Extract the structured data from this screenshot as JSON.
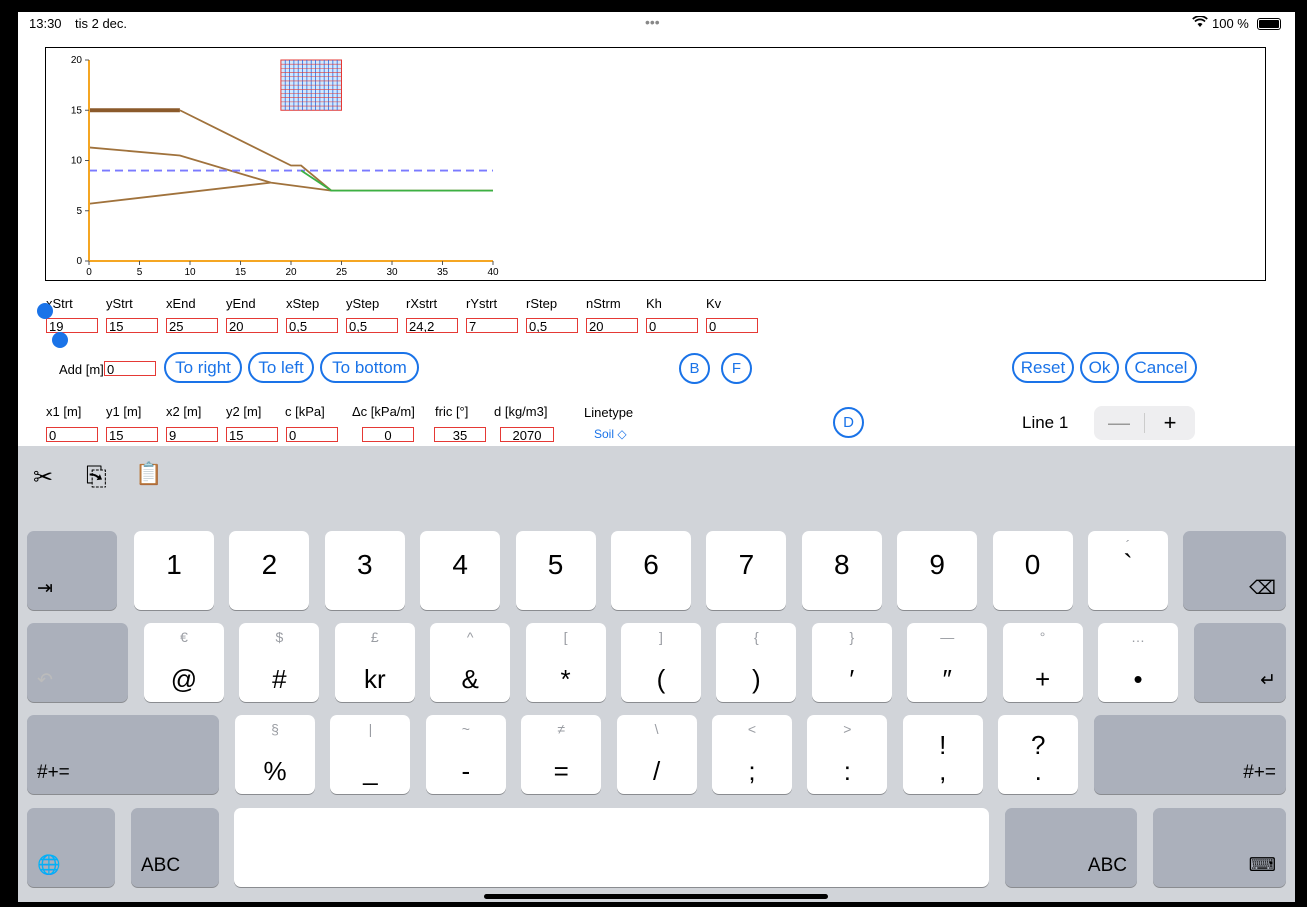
{
  "status": {
    "time": "13:30",
    "date": "tis 2 dec.",
    "battery": "100 %",
    "dots": "•••"
  },
  "chart_data": {
    "type": "line",
    "xlim": [
      0,
      40
    ],
    "ylim": [
      0,
      20
    ],
    "x_ticks": [
      "0",
      "5",
      "10",
      "15",
      "20",
      "25",
      "30",
      "35",
      "40"
    ],
    "y_ticks": [
      "0",
      "5",
      "10",
      "15",
      "20"
    ],
    "series": [
      {
        "values": [
          [
            0,
            15
          ],
          [
            9,
            15
          ]
        ],
        "color": "#8b5a2b"
      },
      {
        "values": [
          [
            9,
            15
          ],
          [
            20,
            9.5
          ],
          [
            21,
            9.5
          ],
          [
            24,
            7
          ],
          [
            40,
            7
          ]
        ],
        "color": "#a0723c"
      },
      {
        "values": [
          [
            0,
            11.3
          ],
          [
            9,
            10.5
          ],
          [
            18,
            7.8
          ],
          [
            24,
            7
          ]
        ],
        "color": "#a0723c"
      },
      {
        "values": [
          [
            0,
            5.7
          ],
          [
            18,
            7.8
          ]
        ],
        "color": "#a0723c"
      },
      {
        "values": [
          [
            0,
            9
          ],
          [
            40,
            9
          ]
        ],
        "color": "#7a7aff",
        "dash": true
      },
      {
        "values": [
          [
            21,
            9
          ],
          [
            24,
            7
          ],
          [
            40,
            7
          ]
        ],
        "color": "#3cb043"
      }
    ],
    "grid_region": {
      "x": [
        19,
        25
      ],
      "y": [
        15,
        20
      ]
    }
  },
  "row1": {
    "labels": [
      "xStrt",
      "yStrt",
      "xEnd",
      "yEnd",
      "xStep",
      "yStep",
      "rXstrt",
      "rYstrt",
      "rStep",
      "nStrm",
      "Kh",
      "Kv"
    ],
    "values": [
      "19",
      "15",
      "25",
      "20",
      "0,5",
      "0,5",
      "24,2",
      "7",
      "0,5",
      "20",
      "0",
      "0"
    ]
  },
  "add": {
    "label": "Add [m]",
    "value": "0"
  },
  "buttons": {
    "to_right": "To right",
    "to_left": "To left",
    "to_bottom": "To bottom",
    "b": "B",
    "f": "F",
    "reset": "Reset",
    "ok": "Ok",
    "cancel": "Cancel",
    "d": "D"
  },
  "row2": {
    "labels": [
      "x1 [m]",
      "y1 [m]",
      "x2 [m]",
      "y2 [m]",
      "c [kPa]",
      "Δc [kPa/m]",
      "fric [°]",
      "d [kg/m3]"
    ],
    "values": [
      "0",
      "15",
      "9",
      "15",
      "0",
      "0",
      "35",
      "2070"
    ]
  },
  "linetype": {
    "label": "Linetype",
    "value": "Soil ◇"
  },
  "line": {
    "label": "Line 1",
    "minus": "—",
    "plus": "+"
  },
  "keyboard": {
    "row1": [
      "1",
      "2",
      "3",
      "4",
      "5",
      "6",
      "7",
      "8",
      "9",
      "0",
      "`"
    ],
    "row1_sec": [
      "",
      "",
      "",
      "",
      "",
      "",
      "",
      "",
      "",
      "",
      "´"
    ],
    "row2": [
      "@",
      "#",
      "kr",
      "&",
      "*",
      "(",
      ")",
      "′",
      "″",
      "+",
      "•"
    ],
    "row2_sec": [
      "€",
      "$",
      "£",
      "^",
      "[",
      "]",
      "{",
      "}",
      "—",
      "°",
      "…"
    ],
    "row3": [
      "%",
      "_",
      "-",
      "=",
      "/",
      ";",
      ":",
      "!\n,",
      "?\n."
    ],
    "row3_sec": [
      "§",
      "|",
      "~",
      "≠",
      "\\",
      "<",
      ">",
      "",
      ""
    ],
    "tab": "⇥",
    "backspace": "⌫",
    "undo": "↶",
    "return": "↵",
    "shift_left": "#+=",
    "shift_right": "#+=",
    "globe": "🌐",
    "abc_left": "ABC",
    "abc_right": "ABC",
    "hide": "⌨",
    "toolbar": {
      "cut": "✂",
      "copy": "⎘",
      "paste": "📋"
    }
  }
}
